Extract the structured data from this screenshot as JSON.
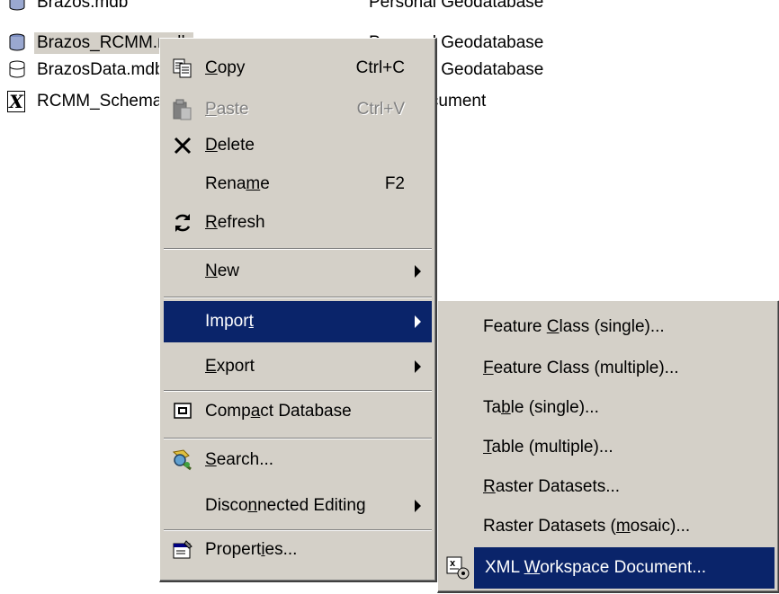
{
  "files": [
    {
      "name": "Brazos.mdb",
      "type": "Personal Geodatabase",
      "icon": "database-icon"
    },
    {
      "name": "Brazos_RCMM.mdb",
      "type": "Personal Geodatabase",
      "icon": "database-icon",
      "selected": true
    },
    {
      "name": "BrazosData.mdb",
      "type": "Personal Geodatabase",
      "icon": "database-icon"
    },
    {
      "name": "RCMM_Schema.xml",
      "type": "XML Document",
      "icon": "xml-document-icon"
    }
  ],
  "context_menu": {
    "items": [
      {
        "label": "Copy",
        "accel": "C",
        "shortcut": "Ctrl+C",
        "icon": "copy-icon"
      },
      {
        "label": "Paste",
        "accel": "P",
        "shortcut": "Ctrl+V",
        "icon": "paste-icon",
        "disabled": true
      },
      {
        "label": "Delete",
        "accel": "D",
        "icon": "delete-icon"
      },
      {
        "label": "Rename",
        "accel": "m",
        "shortcut": "F2"
      },
      {
        "label": "Refresh",
        "accel": "R",
        "icon": "refresh-icon"
      },
      {
        "label": "New",
        "accel": "N",
        "submenu": true
      },
      {
        "label": "Import",
        "accel": "t",
        "submenu": true,
        "highlighted": true
      },
      {
        "label": "Export",
        "accel": "E",
        "submenu": true
      },
      {
        "label": "Compact Database",
        "accel": "a",
        "icon": "compact-database-icon"
      },
      {
        "label": "Search...",
        "accel": "S",
        "icon": "search-icon"
      },
      {
        "label": "Disconnected Editing",
        "accel": "n",
        "submenu": true
      },
      {
        "label": "Properties...",
        "accel": "i",
        "icon": "properties-icon"
      }
    ]
  },
  "import_submenu": {
    "items": [
      {
        "label": "Feature Class (single)...",
        "accel": "C"
      },
      {
        "label": "Feature Class (multiple)...",
        "accel": "F"
      },
      {
        "label": "Table (single)...",
        "accel": "b"
      },
      {
        "label": "Table (multiple)...",
        "accel": "T"
      },
      {
        "label": "Raster Datasets...",
        "accel": "R"
      },
      {
        "label": "Raster Datasets (mosaic)...",
        "accel": "m"
      },
      {
        "label": "XML Workspace Document...",
        "accel": "W",
        "highlighted": true,
        "icon": "xml-workspace-icon"
      }
    ]
  },
  "colors": {
    "menu_bg": "#d4d0c8",
    "highlight": "#0a246a",
    "highlight_text": "#ffffff"
  }
}
